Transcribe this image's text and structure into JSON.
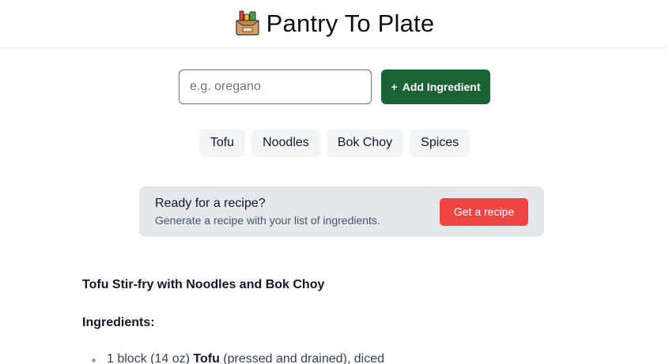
{
  "header": {
    "title": "Pantry To Plate",
    "logo_icon": "pantry-box-icon"
  },
  "ingredient_form": {
    "placeholder": "e.g. oregano",
    "value": "",
    "add_button_label": "Add Ingredient",
    "add_button_icon": "+"
  },
  "chips": [
    "Tofu",
    "Noodles",
    "Bok Choy",
    "Spices"
  ],
  "cta": {
    "title": "Ready for a recipe?",
    "subtitle": "Generate a recipe with your list of ingredients.",
    "button_label": "Get a recipe"
  },
  "recipe": {
    "title": "Tofu Stir-fry with Noodles and Bok Choy",
    "ingredients_heading": "Ingredients:",
    "items": [
      {
        "prefix": "1 block (14 oz) ",
        "bold": "Tofu",
        "suffix": " (pressed and drained), diced"
      }
    ]
  },
  "colors": {
    "add_button": "#1a6334",
    "get_recipe_button": "#ef4444",
    "cta_background": "#e5e7eb",
    "chip_background": "#f3f4f6"
  }
}
